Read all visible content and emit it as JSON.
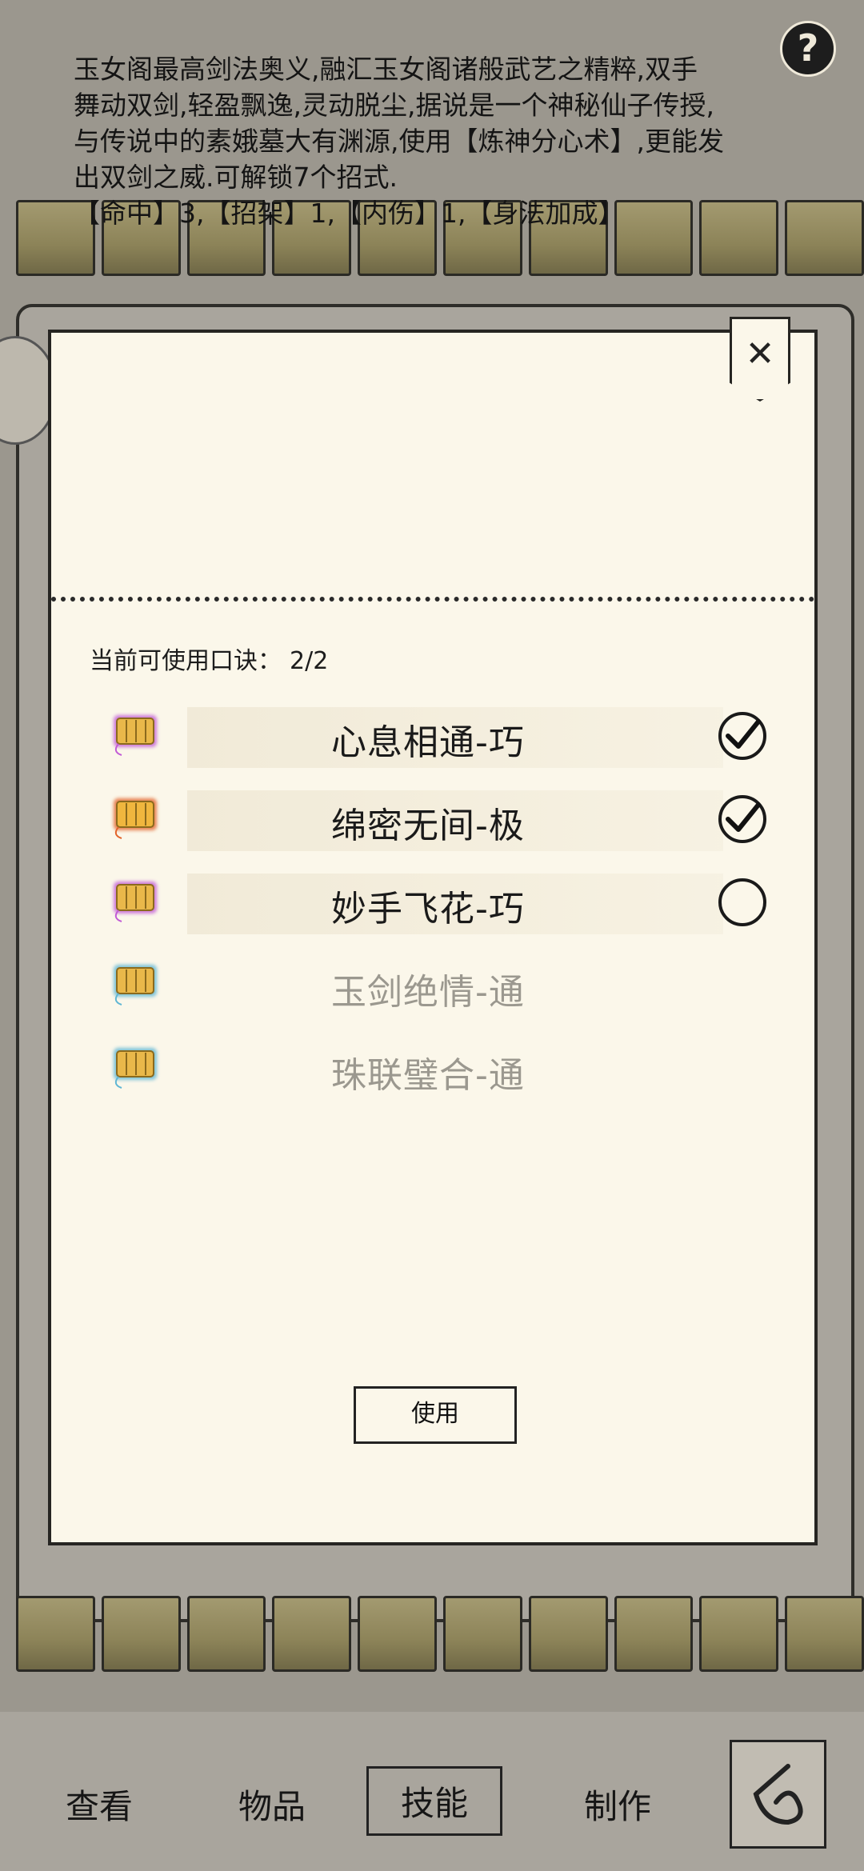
{
  "description": {
    "lines": [
      "玉女阁最高剑法奥义,融汇玉女阁诸般武艺之精粹,双手",
      "舞动双剑,轻盈飘逸,灵动脱尘,据说是一个神秘仙子传授,",
      "与传说中的素娥墓大有渊源,使用【炼神分心术】,更能发",
      "出双剑之威.可解锁7个招式.",
      "【命中】3,【招架】1,【内伤】1,【身法加成】"
    ]
  },
  "modal": {
    "close_icon": "close-x-icon",
    "close_glyph": "✕",
    "usable_label": "当前可使用口诀：",
    "usable_count": "2/2",
    "items": [
      {
        "name": "心息相通-巧",
        "rarity_color": "#c25bd6",
        "checked": true,
        "locked": false
      },
      {
        "name": "绵密无间-极",
        "rarity_color": "#e2632a",
        "checked": true,
        "locked": false
      },
      {
        "name": "妙手飞花-巧",
        "rarity_color": "#c25bd6",
        "checked": false,
        "locked": false
      },
      {
        "name": "玉剑绝情-通",
        "rarity_color": "#5fb6d4",
        "checked": false,
        "locked": true
      },
      {
        "name": "珠联璧合-通",
        "rarity_color": "#5fb6d4",
        "checked": false,
        "locked": true
      }
    ],
    "use_button": "使用"
  },
  "nav": {
    "view": "查看",
    "items": "物品",
    "skills": "技能",
    "craft": "制作",
    "back_icon": "back-arrow-icon"
  },
  "help_glyph": "?",
  "colors": {
    "panel_bg": "#fbf7ea",
    "backdrop": "#9b978e"
  }
}
